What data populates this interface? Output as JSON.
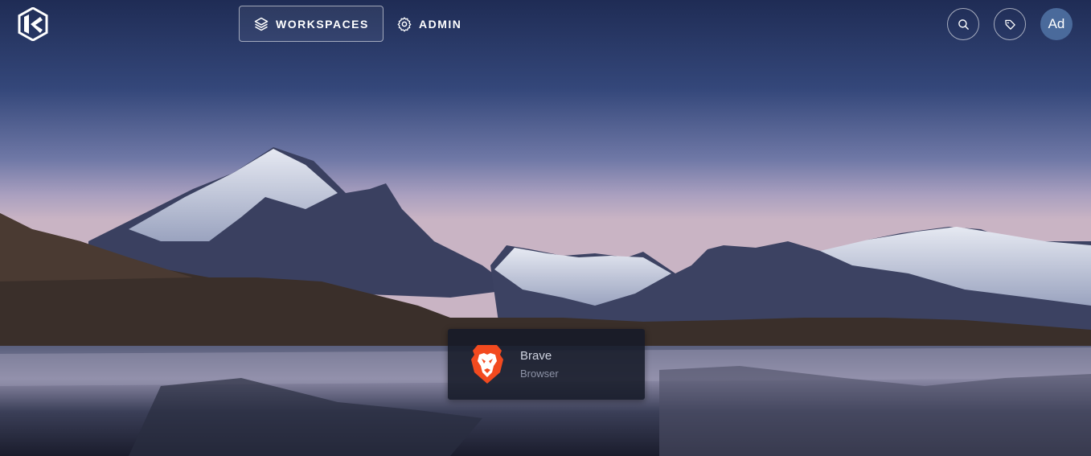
{
  "nav": {
    "workspaces_label": "WORKSPACES",
    "admin_label": "ADMIN"
  },
  "user": {
    "avatar_initials": "Ad"
  },
  "apps": [
    {
      "name": "Brave",
      "type": "Browser",
      "icon": "brave-lion-icon"
    }
  ],
  "colors": {
    "avatar_bg": "#4a6a9b",
    "brave_orange": "#f24a1f"
  }
}
